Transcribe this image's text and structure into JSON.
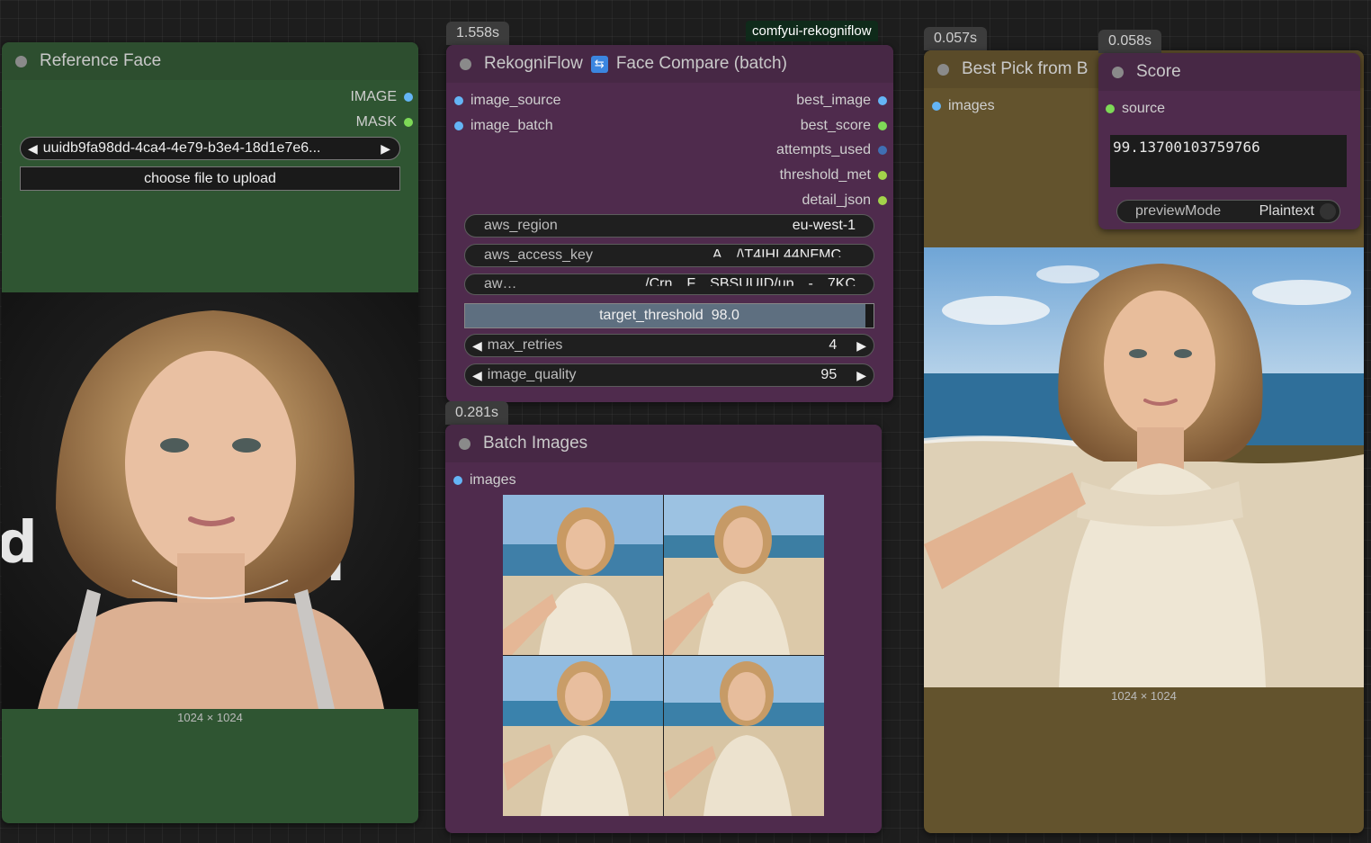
{
  "canvas_badge": "comfyui-rekogniflow",
  "reference_face": {
    "title": "Reference Face",
    "outputs": [
      "IMAGE",
      "MASK"
    ],
    "file_value": "uuidb9fa98dd-4ca4-4e79-b3e4-18d1e7e6...",
    "upload_label": "choose file to upload",
    "image_size": "1024 × 1024"
  },
  "face_compare": {
    "timing": "1.558s",
    "title": "RekogniFlow",
    "title_icon": "refresh-icon",
    "title_suffix": "Face Compare (batch)",
    "inputs": [
      "image_source",
      "image_batch"
    ],
    "outputs": [
      "best_image",
      "best_score",
      "attempts_used",
      "threshold_met",
      "detail_json"
    ],
    "widgets": {
      "aws_region": {
        "label": "aws_region",
        "value": "eu-west-1"
      },
      "aws_access_key": {
        "label": "aws_access_key",
        "value": "A…/\\T4IHL44NFMC…"
      },
      "aws_secret": {
        "label": "aw…",
        "value": "……/Crn…F…SBSUUID/up…-…7KC"
      },
      "target_threshold": {
        "label": "target_threshold",
        "value": "98.0"
      },
      "max_retries": {
        "label": "max_retries",
        "value": "4"
      },
      "image_quality": {
        "label": "image_quality",
        "value": "95"
      }
    }
  },
  "batch_images": {
    "timing": "0.281s",
    "title": "Batch Images",
    "input": "images"
  },
  "best_pick": {
    "timing": "0.057s",
    "title": "Best Pick from B",
    "input": "images",
    "image_size": "1024 × 1024"
  },
  "score": {
    "timing": "0.058s",
    "title": "Score",
    "input": "source",
    "value": "99.13700103759766",
    "preview_label": "previewMode",
    "preview_value": "Plaintext"
  },
  "colors": {
    "green_node": "#2f5532",
    "purple_node": "#4f2b4d",
    "olive_node": "#63532d"
  }
}
